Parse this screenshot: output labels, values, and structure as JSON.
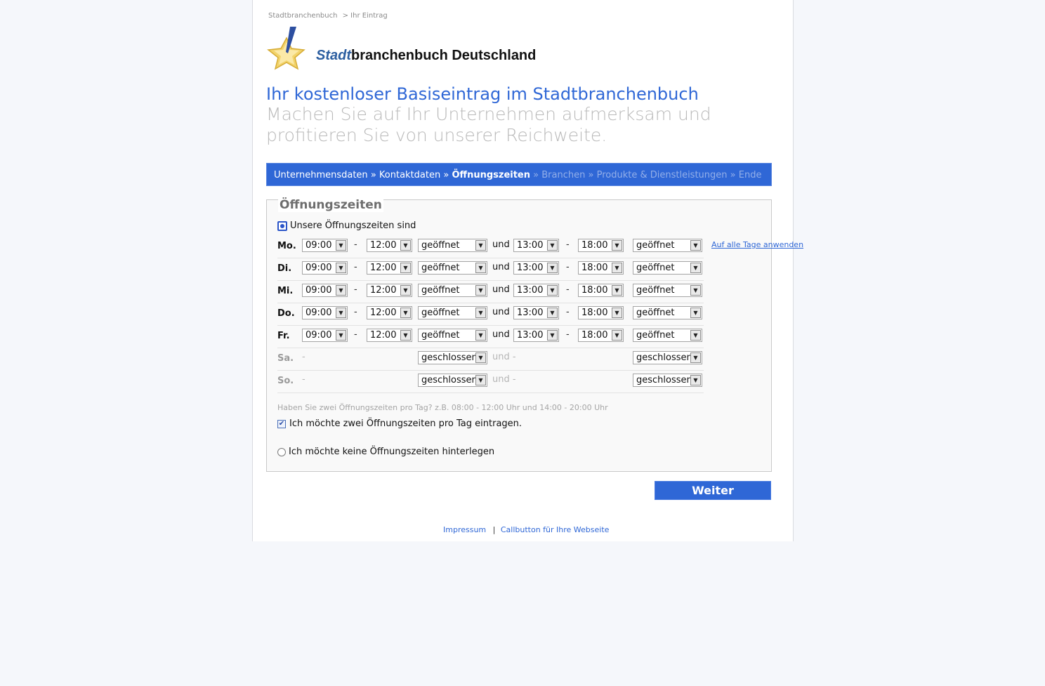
{
  "breadcrumb": {
    "home": "Stadtbranchenbuch",
    "current": "> Ihr Eintrag"
  },
  "logo": {
    "accent": "Stadt",
    "rest": "branchenbuch Deutschland"
  },
  "headline": "Ihr kostenloser Basiseintrag im Stadtbranchenbuch",
  "subline": "Machen Sie auf Ihr Unternehmen aufmerksam und profitieren Sie von unserer Reichweite.",
  "steps": {
    "done": [
      "Unternehmensdaten",
      "Kontaktdaten"
    ],
    "current": "Öffnungszeiten",
    "upcoming": [
      "Branchen",
      "Produkte & Dienstleistungen",
      "Ende"
    ],
    "separator": "»"
  },
  "hours": {
    "legend": "Öffnungszeiten",
    "option_set": "Unsere Öffnungszeiten sind",
    "and_label": "und",
    "dash": "-",
    "apply_all": "Auf alle Tage anwenden",
    "days": [
      {
        "day": "Mo.",
        "from1": "09:00",
        "to1": "12:00",
        "status1": "geöffnet",
        "from2": "13:00",
        "to2": "18:00",
        "status2": "geöffnet",
        "open": true
      },
      {
        "day": "Di.",
        "from1": "09:00",
        "to1": "12:00",
        "status1": "geöffnet",
        "from2": "13:00",
        "to2": "18:00",
        "status2": "geöffnet",
        "open": true
      },
      {
        "day": "Mi.",
        "from1": "09:00",
        "to1": "12:00",
        "status1": "geöffnet",
        "from2": "13:00",
        "to2": "18:00",
        "status2": "geöffnet",
        "open": true
      },
      {
        "day": "Do.",
        "from1": "09:00",
        "to1": "12:00",
        "status1": "geöffnet",
        "from2": "13:00",
        "to2": "18:00",
        "status2": "geöffnet",
        "open": true
      },
      {
        "day": "Fr.",
        "from1": "09:00",
        "to1": "12:00",
        "status1": "geöffnet",
        "from2": "13:00",
        "to2": "18:00",
        "status2": "geöffnet",
        "open": true
      },
      {
        "day": "Sa.",
        "status1": "geschlossen",
        "status2": "geschlossen",
        "open": false
      },
      {
        "day": "So.",
        "status1": "geschlossen",
        "status2": "geschlossen",
        "open": false
      }
    ],
    "hint": "Haben Sie zwei Öffnungszeiten pro Tag? z.B. 08:00 - 12:00 Uhr und 14:00 - 20:00 Uhr",
    "two_times_label": "Ich möchte zwei Öffnungszeiten pro Tag eintragen.",
    "two_times_checked": true,
    "none_label": "Ich möchte keine Öffnungszeiten hinterlegen"
  },
  "next_button": "Weiter",
  "footer": {
    "impressum": "Impressum",
    "separator": "|",
    "callbutton": "Callbutton für Ihre Webseite"
  },
  "colors": {
    "accent": "#2f67d6",
    "page_bg": "#f5f7fb"
  }
}
